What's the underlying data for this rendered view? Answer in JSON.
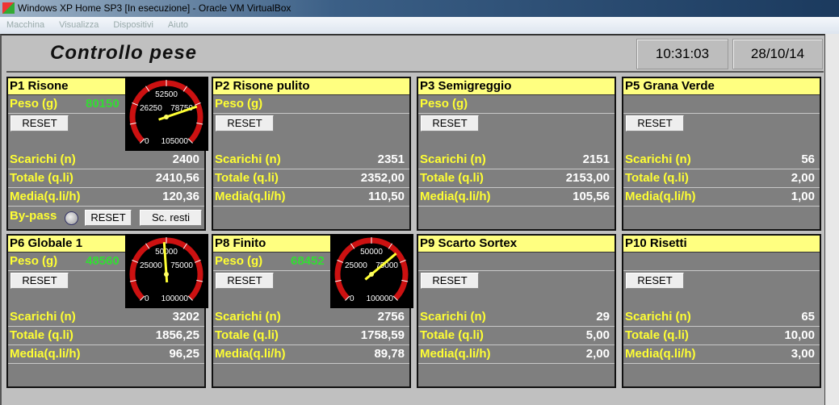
{
  "window": {
    "title": "Windows XP Home SP3 [In esecuzione] - Oracle VM VirtualBox",
    "menu": [
      "Macchina",
      "Visualizza",
      "Dispositivi",
      "Aiuto"
    ]
  },
  "header": {
    "title": "Controllo pese",
    "time": "10:31:03",
    "date": "28/10/14"
  },
  "labels": {
    "peso": "Peso (g)",
    "scarichi": "Scarichi  (n)",
    "totale": "Totale  (q.li)",
    "media": "Media(q.li/h)",
    "reset": "RESET",
    "bypass": "By-pass",
    "sc_resti": "Sc. resti"
  },
  "panels": [
    {
      "name": "P1 Risone",
      "peso": "80150",
      "scarichi": "2400",
      "totale": "2410,56",
      "media": "120,36",
      "gauge": {
        "value": 80150,
        "max": 105000,
        "ticks": [
          "0",
          "26250",
          "52500",
          "78750",
          "105000"
        ]
      },
      "bypass": true
    },
    {
      "name": "P2 Risone pulito",
      "scarichi": "2351",
      "totale": "2352,00",
      "media": "110,50"
    },
    {
      "name": "P3 Semigreggio",
      "scarichi": "2151",
      "totale": "2153,00",
      "media": "105,56"
    },
    {
      "name": "P5 Grana Verde",
      "scarichi": "56",
      "totale": "2,00",
      "media": "1,00"
    },
    {
      "name": "P6 Globale 1",
      "peso": "48560",
      "scarichi": "3202",
      "totale": "1856,25",
      "media": "96,25",
      "gauge": {
        "value": 48560,
        "max": 100000,
        "ticks": [
          "0",
          "25000",
          "50000",
          "75000",
          "100000"
        ]
      }
    },
    {
      "name": "P8 Finito",
      "peso": "68452",
      "scarichi": "2756",
      "totale": "1758,59",
      "media": "89,78",
      "gauge": {
        "value": 68452,
        "max": 100000,
        "ticks": [
          "0",
          "25000",
          "50000",
          "75000",
          "100000"
        ]
      }
    },
    {
      "name": "P9 Scarto Sortex",
      "scarichi": "29",
      "totale": "5,00",
      "media": "2,00"
    },
    {
      "name": "P10 Risetti",
      "scarichi": "65",
      "totale": "10,00",
      "media": "3,00"
    }
  ]
}
